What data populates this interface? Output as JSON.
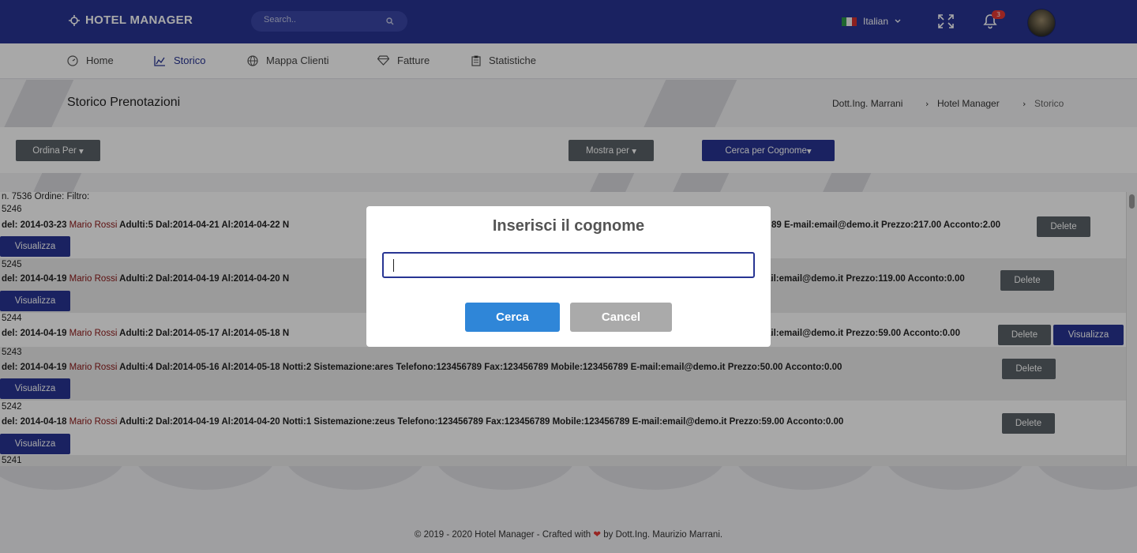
{
  "app": {
    "brand": "HOTEL MANAGER"
  },
  "topbar": {
    "search_placeholder": "Search..",
    "language": "Italian",
    "notifications_count": "3"
  },
  "nav": {
    "items": [
      {
        "label": "Home",
        "icon": "dashboard-icon"
      },
      {
        "label": "Storico",
        "icon": "chart-icon",
        "active": true
      },
      {
        "label": "Mappa Clienti",
        "icon": "globe-icon"
      },
      {
        "label": "Fatture",
        "icon": "diamond-icon"
      },
      {
        "label": "Statistiche",
        "icon": "clipboard-icon"
      }
    ]
  },
  "page": {
    "title": "Storico Prenotazioni",
    "breadcrumb": [
      "Dott.Ing. Marrani",
      "Hotel Manager",
      "Storico"
    ]
  },
  "toolbar": {
    "sort_label": "Ordina Per",
    "show_label": "Mostra per",
    "search_by_label": "Cerca per Cognome"
  },
  "list": {
    "meta": "n. 7536 Ordine: Filtro:",
    "records": [
      {
        "id": "5246",
        "left": "del: 2014-03-23 ",
        "name": "Mario Rossi",
        "mid": " Adulti:5 Dal:2014-04-21 Al:2014-04-22 N",
        "right": "89 E-mail:email@demo.it Prezzo:217.00 Acconto:2.00"
      },
      {
        "id": "5245",
        "left": "del: 2014-04-19 ",
        "name": "Mario Rossi",
        "mid": " Adulti:2 Dal:2014-04-19 Al:2014-04-20 N",
        "right": "ail:email@demo.it Prezzo:119.00 Acconto:0.00"
      },
      {
        "id": "5244",
        "left": "del: 2014-04-19 ",
        "name": "Mario Rossi",
        "mid": " Adulti:2 Dal:2014-05-17 Al:2014-05-18 N",
        "right": "ail:email@demo.it Prezzo:59.00 Acconto:0.00"
      },
      {
        "id": "5243",
        "left": "del: 2014-04-19 ",
        "name": "Mario Rossi",
        "mid": " Adulti:4 Dal:2014-05-16 Al:2014-05-18 Notti:2 Sistemazione:ares Telefono:123456789 Fax:123456789 Mobile:123456789 E-mail:email@demo.it Prezzo:50.00 Acconto:0.00",
        "right": ""
      },
      {
        "id": "5242",
        "left": "del: 2014-04-18 ",
        "name": "Mario Rossi",
        "mid": " Adulti:2 Dal:2014-04-19 Al:2014-04-20 Notti:1 Sistemazione:zeus Telefono:123456789 Fax:123456789 Mobile:123456789 E-mail:email@demo.it Prezzo:59.00 Acconto:0.00",
        "right": ""
      },
      {
        "id": "5241"
      }
    ],
    "delete_label": "Delete",
    "view_label": "Visualizza"
  },
  "footer": {
    "prefix": "© 2019 - 2020 Hotel Manager - Crafted with",
    "suffix": "by Dott.Ing. Maurizio Marrani."
  },
  "modal": {
    "title": "Inserisci il cognome",
    "input_value": "",
    "confirm_label": "Cerca",
    "cancel_label": "Cancel"
  },
  "colors": {
    "primary": "#283593",
    "confirm": "#2f86d8",
    "danger": "#e53935"
  }
}
